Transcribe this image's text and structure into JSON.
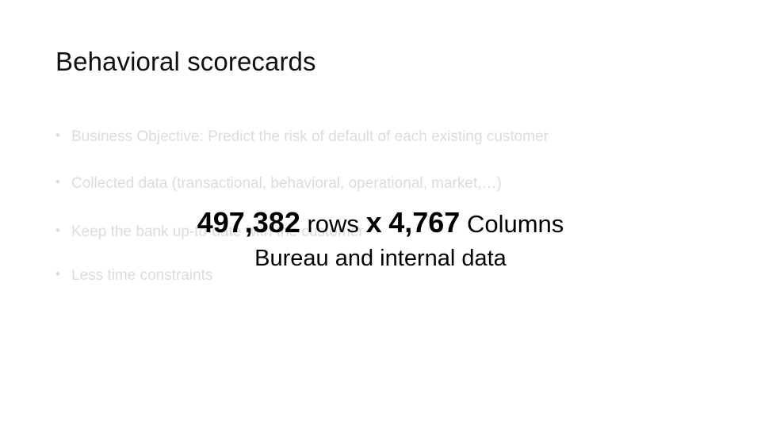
{
  "slide": {
    "title": "Behavioral scorecards",
    "bullets": [
      {
        "marker": "•",
        "text": "Business Objective: Predict the risk of default of each existing customer"
      },
      {
        "marker": "•",
        "text": "Collected data (transactional, behavioral, operational, market,…)"
      },
      {
        "marker": "•",
        "text": "Keep the bank up-to-date with the customer"
      },
      {
        "marker": "•",
        "text": "Less time constraints"
      }
    ],
    "overlay": {
      "rows_value": "497,382",
      "rows_label": "rows",
      "separator": "x",
      "columns_value": "4,767",
      "columns_label": "Columns",
      "subtitle": "Bureau and internal data"
    }
  }
}
